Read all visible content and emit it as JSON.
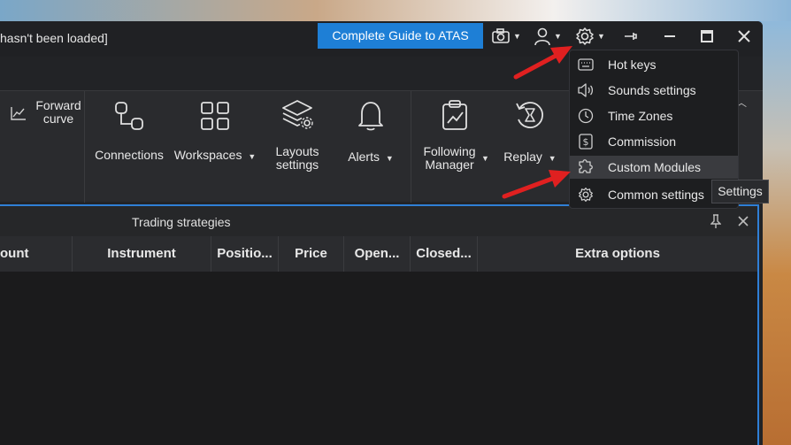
{
  "window": {
    "title": "hasn't been loaded]",
    "guide_button": "Complete Guide to ATAS",
    "toolbar_icons": [
      "camera-icon",
      "user-icon",
      "gear-icon",
      "pin-icon",
      "minimize-icon",
      "maximize-icon",
      "close-icon"
    ]
  },
  "ribbon": {
    "forward_curve": "Forward curve",
    "connections": "Connections",
    "workspaces": "Workspaces",
    "layouts_settings": "Layouts settings",
    "alerts": "Alerts",
    "following_manager": "Following Manager",
    "replay": "Replay"
  },
  "panel": {
    "title": "Trading strategies",
    "columns": [
      "ount",
      "Instrument",
      "Positio...",
      "Price",
      "Open...",
      "Closed...",
      "Extra options"
    ]
  },
  "settings_menu": {
    "items": [
      {
        "label": "Hot keys",
        "icon": "keyboard-icon"
      },
      {
        "label": "Sounds settings",
        "icon": "speaker-icon"
      },
      {
        "label": "Time Zones",
        "icon": "clock-icon"
      },
      {
        "label": "Commission",
        "icon": "dollar-icon"
      },
      {
        "label": "Custom Modules",
        "icon": "puzzle-icon"
      },
      {
        "label": "Common settings",
        "icon": "gear-icon"
      }
    ],
    "hovered": "Custom Modules"
  },
  "tooltip": "Settings",
  "colors": {
    "accent": "#1e7fd6",
    "arrow": "#e02020",
    "background": "#222326"
  }
}
